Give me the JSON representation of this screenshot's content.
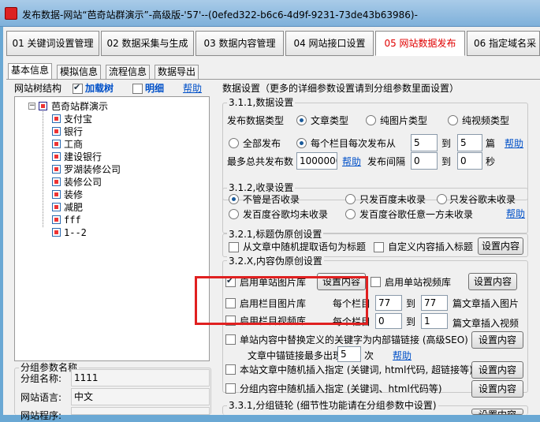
{
  "window": {
    "title": "发布数据-网站“芭奇站群演示”-高级版-'57'--(0efed322-b6c6-4d9f-9231-73de43b63986)-"
  },
  "top_tabs": [
    "01 关键词设置管理",
    "02 数据采集与生成",
    "03 数据内容管理",
    "04 网站接口设置",
    "05 网站数据发布",
    "06 指定域名采"
  ],
  "sub_tabs": [
    "基本信息",
    "模拟信息",
    "流程信息",
    "数据导出"
  ],
  "tree_panel": {
    "label": "网站树结构",
    "load_tree": "加载树",
    "detail": "明细",
    "help": "帮助",
    "root": "芭奇站群演示",
    "children": [
      "支付宝",
      "银行",
      "工商",
      "建设银行",
      "罗湖装修公司",
      "装修公司",
      "装修",
      "减肥",
      "fff",
      "1--2"
    ]
  },
  "group_params": {
    "title": "分组参数名称",
    "name_label": "分组名称:",
    "name_value": "1111",
    "lang_label": "网站语言:",
    "lang_value": "中文",
    "program_label": "网站程序:"
  },
  "settings": {
    "header": "数据设置（更多的详细参数设置请到分组参数里面设置）",
    "s311": {
      "title": "3.1.1,数据设置",
      "type_label": "发布数据类型",
      "type_options": [
        "文章类型",
        "纯图片类型",
        "纯视频类型"
      ],
      "publish_all": "全部发布",
      "per_column_from": "每个栏目每次发布从",
      "per_from": "5",
      "to": "到",
      "per_to": "5",
      "unit_article": "篇",
      "help": "帮助",
      "max_total_label": "最多总共发布数",
      "max_total": "1000000",
      "interval_label": "发布间隔",
      "interval_from": "0",
      "interval_to": "0",
      "unit_sec": "秒"
    },
    "s312": {
      "title": "3.1.2,收录设置",
      "opts": [
        "不管是否收录",
        "只发百度未收录",
        "只发谷歌未收录",
        "发百度谷歌均未收录",
        "发百度谷歌任意一方未收录"
      ],
      "help": "帮助"
    },
    "s321": {
      "title": "3.2.1,标题伪原创设置",
      "opt1": "从文章中随机提取语句为标题",
      "opt2": "自定义内容插入标题",
      "btn": "设置内容"
    },
    "s32x": {
      "title": "3.2.X,内容伪原创设置",
      "image_lib": "启用单站图片库",
      "image_btn": "设置内容",
      "video_lib": "启用单站视频库",
      "video_btn": "设置内容",
      "col_image": "启用栏目图片库",
      "col_video": "启用栏目视频库",
      "per_column": "每个栏目",
      "img_from": "77",
      "img_to": "77",
      "img_suffix": "篇文章插入图片",
      "vid_from": "0",
      "vid_to": "1",
      "vid_suffix": "篇文章插入视频",
      "to": "到",
      "replace_kw": "单站内容中替换定义的关键字为内部锚链接 (高级SEO)",
      "replace_btn": "设置内容",
      "anchor_min_label": "文章中锚链接最多出现",
      "anchor_min": "5",
      "anchor_unit": "次",
      "help": "帮助",
      "insert_site": "本站文章中随机插入指定 (关键词, html代码, 超链接等)",
      "insert_site_btn": "设置内容",
      "insert_group": "分组内容中随机插入指定 (关键词、html代码等)",
      "insert_group_btn": "设置内容"
    },
    "s331": {
      "title": "3.3.1,分组链轮 (细节性功能请在分组参数中设置)",
      "btn": "设置内容"
    }
  }
}
